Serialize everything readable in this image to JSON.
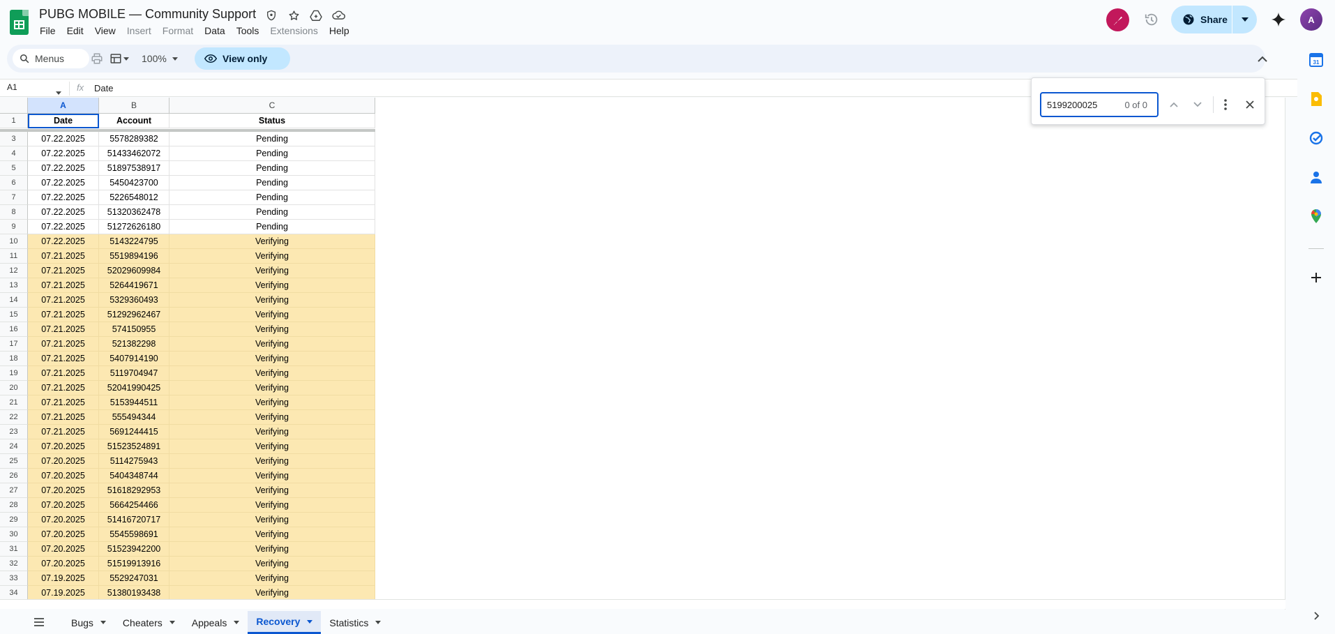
{
  "app": {
    "title": "PUBG MOBILE — Community Support",
    "menu": [
      {
        "label": "File",
        "disabled": false
      },
      {
        "label": "Edit",
        "disabled": false
      },
      {
        "label": "View",
        "disabled": false
      },
      {
        "label": "Insert",
        "disabled": true
      },
      {
        "label": "Format",
        "disabled": true
      },
      {
        "label": "Data",
        "disabled": false
      },
      {
        "label": "Tools",
        "disabled": false
      },
      {
        "label": "Extensions",
        "disabled": true
      },
      {
        "label": "Help",
        "disabled": false
      }
    ],
    "share_label": "Share",
    "user_avatar_initial": "A",
    "colors": {
      "accent": "#0b57d0",
      "share_bg": "#c2e7ff",
      "verifying_row": "#fce8b2",
      "sheets_green": "#0f9d58"
    }
  },
  "toolbar": {
    "menus_label": "Menus",
    "zoom": "100%",
    "view_only_label": "View only"
  },
  "formula_bar": {
    "cell_ref": "A1",
    "fx": "fx",
    "content": "Date"
  },
  "grid": {
    "columns": [
      "A",
      "B",
      "C"
    ],
    "header": {
      "row_num": "1",
      "cells": [
        "Date",
        "Account",
        "Status"
      ]
    },
    "rows": [
      {
        "n": "3",
        "cells": [
          "07.22.2025",
          "5578289382",
          "Pending"
        ]
      },
      {
        "n": "4",
        "cells": [
          "07.22.2025",
          "51433462072",
          "Pending"
        ]
      },
      {
        "n": "5",
        "cells": [
          "07.22.2025",
          "51897538917",
          "Pending"
        ]
      },
      {
        "n": "6",
        "cells": [
          "07.22.2025",
          "5450423700",
          "Pending"
        ]
      },
      {
        "n": "7",
        "cells": [
          "07.22.2025",
          "5226548012",
          "Pending"
        ]
      },
      {
        "n": "8",
        "cells": [
          "07.22.2025",
          "51320362478",
          "Pending"
        ]
      },
      {
        "n": "9",
        "cells": [
          "07.22.2025",
          "51272626180",
          "Pending"
        ]
      },
      {
        "n": "10",
        "cells": [
          "07.22.2025",
          "5143224795",
          "Verifying"
        ]
      },
      {
        "n": "11",
        "cells": [
          "07.21.2025",
          "5519894196",
          "Verifying"
        ]
      },
      {
        "n": "12",
        "cells": [
          "07.21.2025",
          "52029609984",
          "Verifying"
        ]
      },
      {
        "n": "13",
        "cells": [
          "07.21.2025",
          "5264419671",
          "Verifying"
        ]
      },
      {
        "n": "14",
        "cells": [
          "07.21.2025",
          "5329360493",
          "Verifying"
        ]
      },
      {
        "n": "15",
        "cells": [
          "07.21.2025",
          "51292962467",
          "Verifying"
        ]
      },
      {
        "n": "16",
        "cells": [
          "07.21.2025",
          "574150955",
          "Verifying"
        ]
      },
      {
        "n": "17",
        "cells": [
          "07.21.2025",
          "521382298",
          "Verifying"
        ]
      },
      {
        "n": "18",
        "cells": [
          "07.21.2025",
          "5407914190",
          "Verifying"
        ]
      },
      {
        "n": "19",
        "cells": [
          "07.21.2025",
          "5119704947",
          "Verifying"
        ]
      },
      {
        "n": "20",
        "cells": [
          "07.21.2025",
          "52041990425",
          "Verifying"
        ]
      },
      {
        "n": "21",
        "cells": [
          "07.21.2025",
          "5153944511",
          "Verifying"
        ]
      },
      {
        "n": "22",
        "cells": [
          "07.21.2025",
          "555494344",
          "Verifying"
        ]
      },
      {
        "n": "23",
        "cells": [
          "07.21.2025",
          "5691244415",
          "Verifying"
        ]
      },
      {
        "n": "24",
        "cells": [
          "07.20.2025",
          "51523524891",
          "Verifying"
        ]
      },
      {
        "n": "25",
        "cells": [
          "07.20.2025",
          "5114275943",
          "Verifying"
        ]
      },
      {
        "n": "26",
        "cells": [
          "07.20.2025",
          "5404348744",
          "Verifying"
        ]
      },
      {
        "n": "27",
        "cells": [
          "07.20.2025",
          "51618292953",
          "Verifying"
        ]
      },
      {
        "n": "28",
        "cells": [
          "07.20.2025",
          "5664254466",
          "Verifying"
        ]
      },
      {
        "n": "29",
        "cells": [
          "07.20.2025",
          "51416720717",
          "Verifying"
        ]
      },
      {
        "n": "30",
        "cells": [
          "07.20.2025",
          "5545598691",
          "Verifying"
        ]
      },
      {
        "n": "31",
        "cells": [
          "07.20.2025",
          "51523942200",
          "Verifying"
        ]
      },
      {
        "n": "32",
        "cells": [
          "07.20.2025",
          "51519913916",
          "Verifying"
        ]
      },
      {
        "n": "33",
        "cells": [
          "07.19.2025",
          "5529247031",
          "Verifying"
        ]
      },
      {
        "n": "34",
        "cells": [
          "07.19.2025",
          "51380193438",
          "Verifying"
        ]
      }
    ]
  },
  "find": {
    "query": "5199200025",
    "count": "0 of 0"
  },
  "sheets": {
    "tabs": [
      {
        "label": "Bugs",
        "active": false
      },
      {
        "label": "Cheaters",
        "active": false
      },
      {
        "label": "Appeals",
        "active": false
      },
      {
        "label": "Recovery",
        "active": true
      },
      {
        "label": "Statistics",
        "active": false
      }
    ]
  },
  "side_panel": {
    "icons": [
      "calendar-icon",
      "keep-icon",
      "tasks-icon",
      "contacts-icon",
      "maps-icon",
      "add-icon"
    ],
    "calendar_day": "31"
  }
}
